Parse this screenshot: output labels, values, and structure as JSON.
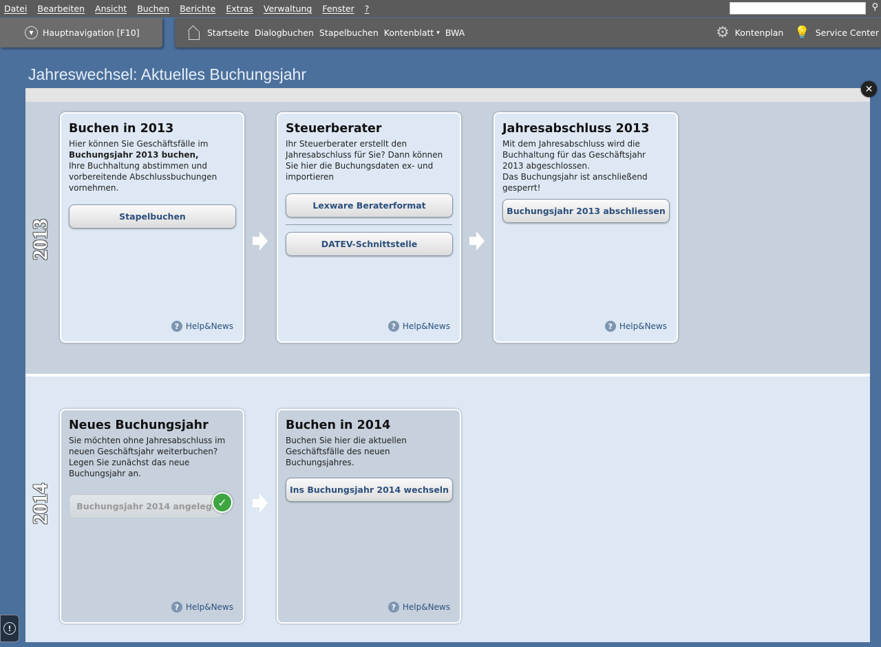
{
  "menu": [
    "Datei",
    "Bearbeiten",
    "Ansicht",
    "Buchen",
    "Berichte",
    "Extras",
    "Verwaltung",
    "Fenster",
    "?"
  ],
  "search": {
    "placeholder": "",
    "icon": "search-icon"
  },
  "nav": {
    "main": "Hauptnavigation [F10]",
    "items": [
      "Startseite",
      "Dialogbuchen",
      "Stapelbuchen",
      "Kontenblatt",
      "BWA"
    ],
    "dropdown": "▾",
    "kontenplan": "Kontenplan",
    "service": "Service Center"
  },
  "title": "Jahreswechsel: Aktuelles Buchungsjahr",
  "help": "Help&News",
  "y2013": {
    "year": "2013",
    "cards": [
      {
        "title": "Buchen in 2013",
        "text_pre": "Hier können Sie Geschäftsfälle im",
        "text_bold": "Buchungsjahr 2013 buchen,",
        "text_post": "Ihre Buchhaltung abstimmen und vorbereitende Abschlussbuchungen vornehmen.",
        "buttons": [
          "Stapelbuchen"
        ]
      },
      {
        "title": "Steuerberater",
        "text": "Ihr Steuerberater erstellt den Jahresabschluss für Sie? Dann können Sie hier die Buchungsdaten ex- und importieren",
        "buttons": [
          "Lexware Beraterformat",
          "DATEV-Schnittstelle"
        ]
      },
      {
        "title": "Jahresabschluss 2013",
        "text": "Mit dem Jahresabschluss wird die Buchhaltung für das Geschäftsjahr 2013 abgeschlossen.",
        "text2": "Das Buchungsjahr ist anschließend gesperrt!",
        "buttons": [
          "Buchungsjahr 2013 abschliessen"
        ]
      }
    ]
  },
  "y2014": {
    "year": "2014",
    "cards": [
      {
        "title": "Neues Buchungsjahr",
        "text": "Sie möchten ohne Jahresabschluss im neuen Geschäftsjahr weiterbuchen? Legen Sie zunächst das neue Buchungsjahr an.",
        "buttons": [
          "Buchungsjahr 2014 angelegt"
        ],
        "done": true
      },
      {
        "title": "Buchen in 2014",
        "text": "Buchen Sie hier die aktuellen Geschäftsfälle des neuen Buchungsjahres.",
        "buttons": [
          "Ins Buchungsjahr 2014 wechseln"
        ]
      }
    ]
  }
}
